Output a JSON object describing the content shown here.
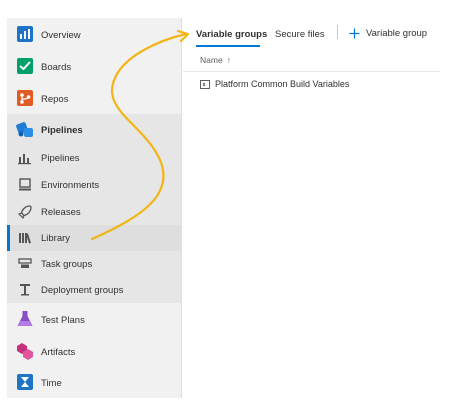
{
  "sidebar": {
    "items": [
      {
        "label": "Overview",
        "icon": "overview-icon"
      },
      {
        "label": "Boards",
        "icon": "boards-icon"
      },
      {
        "label": "Repos",
        "icon": "repos-icon"
      },
      {
        "label": "Pipelines",
        "icon": "pipelines-icon",
        "section_header": true
      },
      {
        "label": "Pipelines",
        "icon": "pipeline-run-icon"
      },
      {
        "label": "Environments",
        "icon": "environments-icon"
      },
      {
        "label": "Releases",
        "icon": "rocket-icon"
      },
      {
        "label": "Library",
        "icon": "library-icon",
        "selected": true
      },
      {
        "label": "Task groups",
        "icon": "task-groups-icon"
      },
      {
        "label": "Deployment groups",
        "icon": "deployment-groups-icon"
      },
      {
        "label": "Test Plans",
        "icon": "flask-icon"
      },
      {
        "label": "Artifacts",
        "icon": "artifacts-icon"
      },
      {
        "label": "Time",
        "icon": "hourglass-icon"
      }
    ]
  },
  "tabs": {
    "variable_groups": "Variable groups",
    "secure_files": "Secure files",
    "add_variable_group": "Variable group"
  },
  "table": {
    "column_name": "Name",
    "sort_indicator": "↑",
    "rows": [
      {
        "name": "Platform Common Build Variables",
        "icon": "variable-group-icon"
      }
    ]
  },
  "colors": {
    "accent": "#0078d4",
    "annotation_arrow": "#f2b515",
    "sidebar_bg": "#f1f1f1"
  }
}
